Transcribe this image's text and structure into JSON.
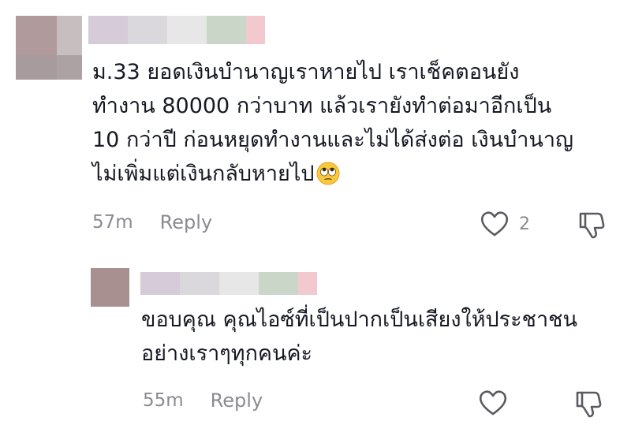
{
  "comments": [
    {
      "lines": [
        "ม.33 ยอดเงินบำนาญเราหายไป เราเช็คตอนยัง",
        "ทำงาน 80000 กว่าบาท แล้วเรายังทำต่อมาอีกเป็น",
        "10 กว่าปี ก่อนหยุดทำงานและไม่ได้ส่งต่อ เงินบำนาญ",
        "ไม่เพิ่มแต่เงินกลับหายไป"
      ],
      "emoji": "face-with-rolling-eyes-icon",
      "timestamp": "57m",
      "reply_label": "Reply",
      "like_count": "2"
    },
    {
      "lines": [
        "ขอบคุณ คุณไอซ์ที่เป็นปากเป็นเสียงให้ประชาชน",
        "อย่างเราๆทุกคนค่ะ"
      ],
      "timestamp": "55m",
      "reply_label": "Reply",
      "like_count": ""
    }
  ],
  "colors": {
    "text": "#161823",
    "meta": "#8a8b91",
    "icon_stroke": "#5a5b60"
  }
}
